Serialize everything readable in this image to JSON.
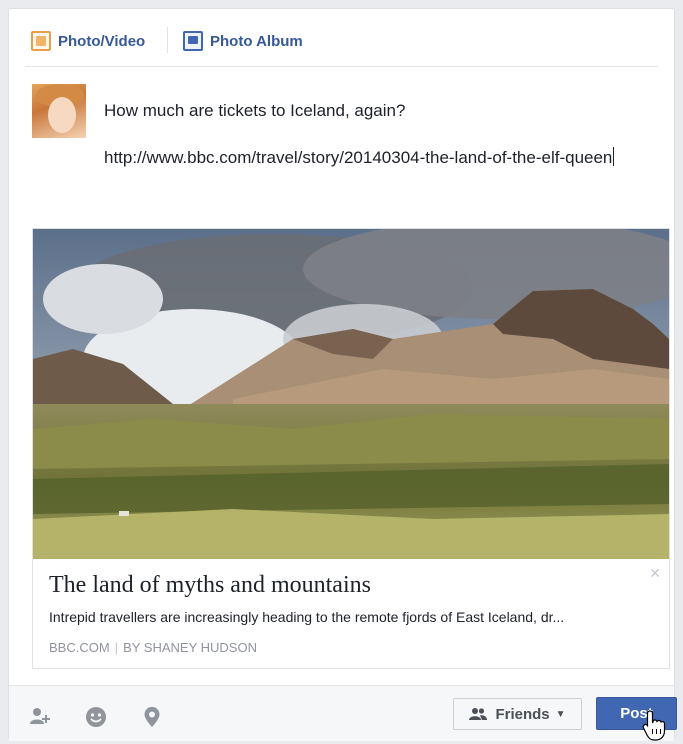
{
  "tabs": {
    "photo_video": "Photo/Video",
    "photo_album": "Photo Album"
  },
  "post": {
    "question": "How much are tickets to Iceland, again?",
    "url": "http://www.bbc.com/travel/story/20140304-the-land-of-the-elf-queen"
  },
  "link_preview": {
    "title": "The land of myths and mountains",
    "description": "Intrepid travellers are increasingly heading to the remote fjords of East Iceland, dr...",
    "source": "BBC.COM",
    "separator": "|",
    "author": "BY SHANEY HUDSON",
    "close_icon": "close-icon"
  },
  "bottom": {
    "icons": [
      "tag-friends-icon",
      "feeling-icon",
      "location-icon"
    ],
    "audience_label": "Friends",
    "post_label": "Post"
  },
  "colors": {
    "brand_blue": "#4267b2",
    "link_blue": "#365899",
    "photo_orange": "#e8a04b"
  }
}
